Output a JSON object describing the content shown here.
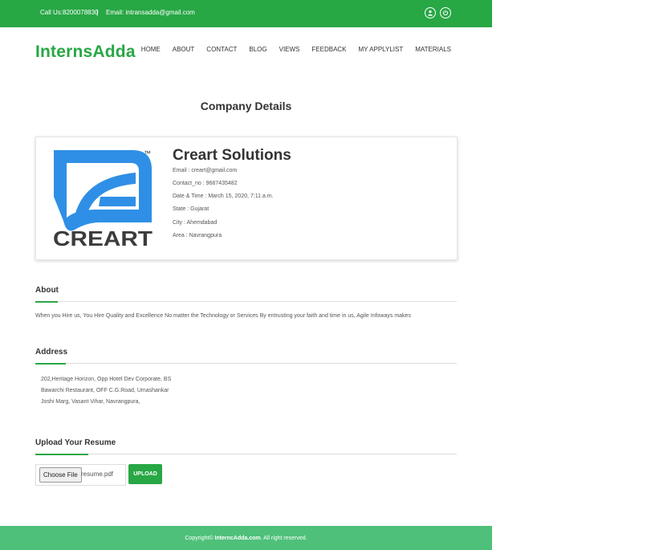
{
  "topbar": {
    "call": "Call Us:8200078830",
    "separator": "|",
    "email": "Email: intransadda@gmail.com",
    "icons": [
      "user-icon",
      "power-icon"
    ]
  },
  "brand": "InternsAdda",
  "nav": [
    "HOME",
    "ABOUT",
    "CONTACT",
    "BLOG",
    "VIEWS",
    "FEEDBACK",
    "MY APPLYLIST",
    "MATERIALS"
  ],
  "page_title": "Company Details",
  "company": {
    "logo_text": "CREART",
    "logo_tm": "™",
    "logo_color": "#2f8fe6",
    "name": "Creart Solutions",
    "email": "Email : creart@gmail.com",
    "contact": "Contact_no : 9687435482",
    "datetime": "Date & Time : March 15, 2020, 7:11 a.m.",
    "state": "State : Gujarat",
    "city": "City : Ahemdabad",
    "area": "Area : Navrangpura"
  },
  "about": {
    "title": "About",
    "text": "When you Hire us, You Hire Quality and Excellence No matter the Technology or Services By entrusting your faith and time in us, Agile Infoways makes"
  },
  "address": {
    "title": "Address",
    "lines": [
      "202,Heritage Horizon, Opp Hotel Dev Corporate, BS",
      "Bawarchi Restaurant, OFF C.G.Road, Umashankar",
      "Joshi Marg, Vasant Vihar, Navrangpura,"
    ]
  },
  "upload": {
    "title": "Upload Your Resume",
    "choose_label": "Choose File",
    "file_name": "resume.pdf",
    "button": "UPLOAD"
  },
  "footer": {
    "prefix": "Copyright©",
    "site": "InterncAdda.com",
    "suffix": ". All right reserved."
  },
  "colors": {
    "accent": "#28a745",
    "footer": "#4fc07a"
  }
}
